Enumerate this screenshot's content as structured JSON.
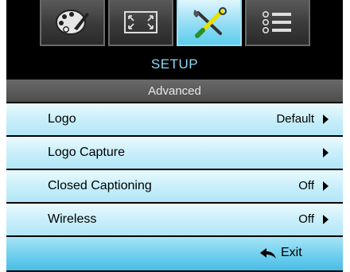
{
  "tabs": [
    {
      "name": "image-settings",
      "icon": "palette-icon"
    },
    {
      "name": "display",
      "icon": "screen-resize-icon"
    },
    {
      "name": "setup",
      "icon": "tools-icon",
      "active": true
    },
    {
      "name": "options",
      "icon": "list-icon"
    }
  ],
  "header": {
    "title": "SETUP",
    "subtitle": "Advanced"
  },
  "menu": {
    "items": [
      {
        "label": "Logo",
        "value": "Default"
      },
      {
        "label": "Logo Capture",
        "value": ""
      },
      {
        "label": "Closed Captioning",
        "value": "Off"
      },
      {
        "label": "Wireless",
        "value": "Off"
      }
    ]
  },
  "footer": {
    "exit_label": "Exit"
  },
  "colors": {
    "accent_title": "#8fd9f2",
    "item_bg": "#c9effa",
    "footer_bg": "#6fcfee"
  }
}
